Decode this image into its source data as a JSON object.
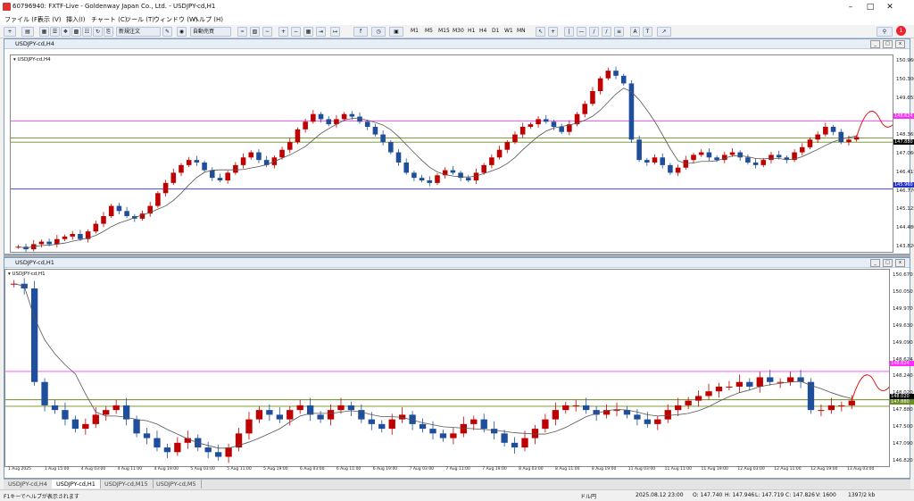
{
  "window": {
    "title": "60796940: FXTF-Live - Goldenway Japan Co., Ltd. - USDJPY-cd,H1"
  },
  "menu": [
    "ファイル (F)",
    "表示 (V)",
    "挿入(I)",
    "チャート (C)",
    "ツール (T)",
    "ウィンドウ (W)",
    "ヘルプ (H)"
  ],
  "toolbar": {
    "new_order": "新規注文",
    "auto_trade": "自動売買",
    "timeframes": [
      "M1",
      "M5",
      "M15",
      "M30",
      "H1",
      "H4",
      "D1",
      "W1",
      "MN"
    ],
    "letter_a": "A",
    "letter_t": "T"
  },
  "top_chart": {
    "window_title": "USDJPY-cd,H4",
    "label": "USDJPY-cd,H4",
    "y_ticks": [
      "150.960",
      "150.300",
      "149.655",
      "149.000",
      "148.365",
      "147.060",
      "146.415",
      "146.770",
      "145.125",
      "144.480",
      "143.820"
    ],
    "price_tags": [
      {
        "text": "148.624",
        "color": "#ff2bff",
        "yfrac": 0.3
      },
      {
        "text": "147.880",
        "color": "#000000",
        "yfrac": 0.43
      },
      {
        "text": "145.960",
        "color": "#2233cc",
        "yfrac": 0.65
      }
    ],
    "lines": [
      {
        "value": 148.624,
        "color": "#ff40ff"
      },
      {
        "value": 147.96,
        "color": "#6b8e23"
      },
      {
        "value": 147.8,
        "color": "#6b8e23"
      },
      {
        "value": 145.96,
        "color": "#2233cc"
      }
    ],
    "chart_data": {
      "type": "candlestick",
      "ylim": [
        143.5,
        151.2
      ],
      "series": [
        {
          "name": "close",
          "values": [
            143.7,
            143.6,
            143.8,
            143.9,
            143.8,
            144.0,
            144.1,
            144.2,
            144.0,
            144.3,
            144.6,
            144.9,
            145.3,
            145.1,
            144.9,
            144.8,
            145.0,
            145.3,
            145.8,
            146.2,
            146.6,
            146.9,
            147.1,
            147.0,
            146.7,
            146.4,
            146.3,
            146.6,
            146.9,
            147.2,
            147.4,
            147.1,
            146.9,
            147.2,
            147.5,
            147.8,
            148.3,
            148.6,
            148.9,
            148.7,
            148.5,
            148.7,
            148.9,
            148.8,
            148.6,
            148.4,
            148.1,
            147.8,
            147.4,
            147.0,
            146.6,
            146.4,
            146.3,
            146.2,
            146.5,
            146.7,
            146.6,
            146.4,
            146.3,
            146.6,
            146.9,
            147.2,
            147.5,
            147.8,
            148.1,
            148.4,
            148.5,
            148.7,
            148.6,
            148.4,
            148.2,
            148.5,
            148.9,
            149.3,
            149.8,
            150.3,
            150.6,
            150.4,
            150.1,
            147.9,
            147.1,
            147.0,
            147.2,
            146.9,
            146.6,
            146.8,
            147.1,
            147.3,
            147.4,
            147.2,
            147.1,
            147.3,
            147.4,
            147.2,
            147.0,
            146.9,
            147.1,
            147.3,
            147.2,
            147.1,
            147.4,
            147.6,
            147.9,
            148.1,
            148.4,
            148.2,
            147.8,
            147.9,
            148.0
          ]
        }
      ]
    }
  },
  "bottom_chart": {
    "window_title": "USDJPY-cd,H1",
    "label": "USDJPY-cd,H1",
    "y_ticks": [
      "150.670",
      "150.050",
      "149.970",
      "149.630",
      "149.090",
      "148.624",
      "148.240",
      "148.020",
      "147.880",
      "147.500",
      "147.090",
      "146.820"
    ],
    "price_tags": [
      {
        "text": "148.624",
        "color": "#ff2bff",
        "yfrac": 0.47
      },
      {
        "text": "148.020",
        "color": "#000000",
        "yfrac": 0.635
      },
      {
        "text": "147.880",
        "color": "#6b8e23",
        "yfrac": 0.665
      }
    ],
    "lines": [
      {
        "value": 148.624,
        "color": "#ff40ff"
      },
      {
        "value": 148.02,
        "color": "#6b8e23"
      },
      {
        "value": 147.88,
        "color": "#6b8e23"
      }
    ],
    "x_labels": [
      "1 Aug 2025",
      "1 Aug 15:00",
      "4 Aug 03:00",
      "4 Aug 11:00",
      "4 Aug 19:00",
      "5 Aug 03:00",
      "5 Aug 11:00",
      "5 Aug 19:00",
      "6 Aug 03:00",
      "6 Aug 11:00",
      "6 Aug 19:00",
      "7 Aug 03:00",
      "7 Aug 11:00",
      "7 Aug 19:00",
      "8 Aug 03:00",
      "8 Aug 11:00",
      "8 Aug 19:00",
      "11 Aug 03:00",
      "11 Aug 11:00",
      "11 Aug 19:00",
      "12 Aug 03:00",
      "12 Aug 11:00",
      "12 Aug 19:00",
      "13 Aug 03:00"
    ],
    "chart_data": {
      "type": "candlestick",
      "ylim": [
        146.6,
        150.8
      ],
      "series": [
        {
          "name": "close",
          "values": [
            150.5,
            150.4,
            148.4,
            147.9,
            147.8,
            147.6,
            147.4,
            147.5,
            147.7,
            147.8,
            147.9,
            147.6,
            147.3,
            147.2,
            147.0,
            146.9,
            147.1,
            147.2,
            147.0,
            146.9,
            146.8,
            147.0,
            147.3,
            147.6,
            147.8,
            147.7,
            147.6,
            147.8,
            147.9,
            147.7,
            147.6,
            147.8,
            147.9,
            147.8,
            147.6,
            147.5,
            147.4,
            147.6,
            147.7,
            147.5,
            147.4,
            147.3,
            147.2,
            147.3,
            147.5,
            147.6,
            147.4,
            147.3,
            147.1,
            147.0,
            147.2,
            147.4,
            147.6,
            147.8,
            147.9,
            147.9,
            147.8,
            147.7,
            147.8,
            147.8,
            147.7,
            147.6,
            147.5,
            147.6,
            147.8,
            147.9,
            148.0,
            148.1,
            148.2,
            148.3,
            148.3,
            148.4,
            148.3,
            148.5,
            148.4,
            148.4,
            148.5,
            148.4,
            147.8,
            147.8,
            147.9,
            147.9,
            148.0
          ]
        }
      ]
    }
  },
  "tabs": [
    "USDJPY-cd,H4",
    "USDJPY-cd,H1",
    "USDJPY-cd,M15",
    "USDJPY-cd,M5"
  ],
  "status": {
    "help": "F1キーでヘルプが表示されます",
    "profile": "ドル円",
    "datetime": "2025.08.12 23:00",
    "open": "O: 147.740",
    "high": "H: 147.946",
    "low": "L: 147.719",
    "close": "C: 147.826",
    "volume": "V: 1600",
    "traffic": "1397/2 kb"
  }
}
